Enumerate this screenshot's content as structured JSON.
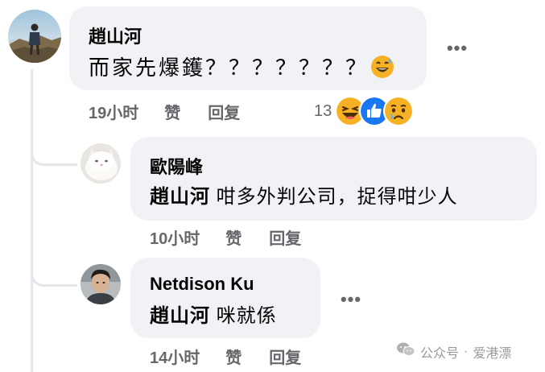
{
  "main_comment": {
    "author": "趙山河",
    "text": "而家先爆鑊？？？？？？？",
    "emoji": "grinning-sweat-emoji",
    "time": "19小时",
    "like_label": "赞",
    "reply_label": "回复",
    "reaction_count": "13",
    "reactions": [
      "haha-reaction-icon",
      "like-reaction-icon",
      "sad-reaction-icon"
    ]
  },
  "replies": [
    {
      "author": "歐陽峰",
      "mention": "趙山河",
      "text": "咁多外判公司，捉得咁少人",
      "time": "10小时",
      "like_label": "赞",
      "reply_label": "回复"
    },
    {
      "author": "Netdison Ku",
      "mention": "趙山河",
      "text": "咪就係",
      "time": "14小时",
      "like_label": "赞",
      "reply_label": "回复"
    }
  ],
  "more_label": "•••",
  "watermark": {
    "source": "公众号",
    "separator": "·",
    "name": "爱港漂"
  },
  "colors": {
    "bubble": "#f0f2f5",
    "meta_text": "#65676b",
    "like_blue": "#1877f2",
    "emoji_yellow": "#f7b125",
    "thread_line": "#e4e6eb"
  }
}
